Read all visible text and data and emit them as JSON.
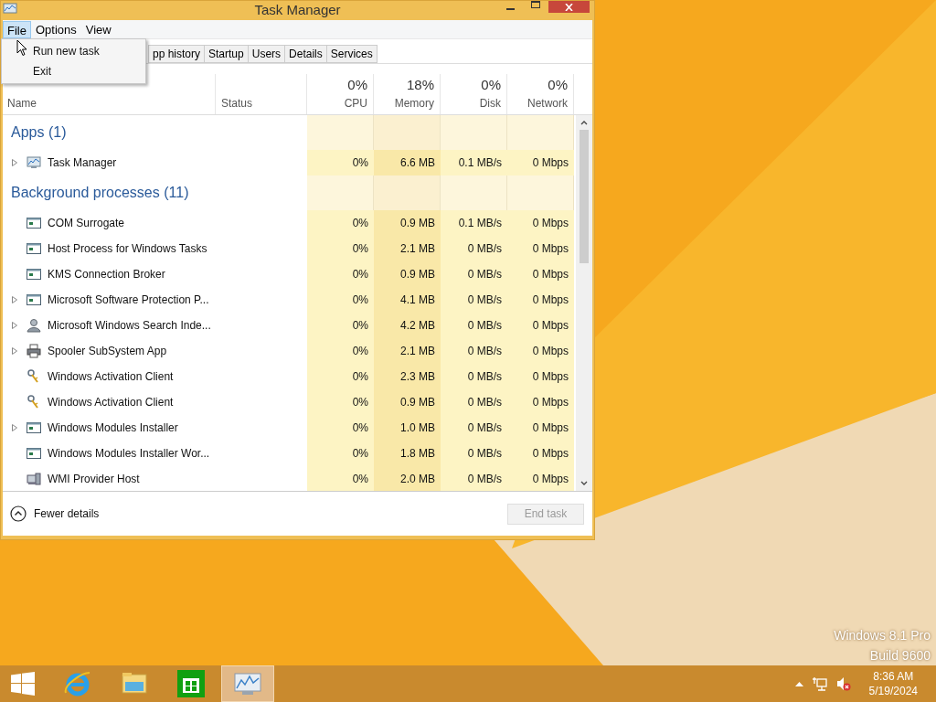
{
  "window": {
    "title": "Task Manager"
  },
  "menu_bar": [
    {
      "label": "File",
      "selected": true
    },
    {
      "label": "Options",
      "selected": false
    },
    {
      "label": "View",
      "selected": false
    }
  ],
  "file_menu": [
    "Run new task",
    "Exit"
  ],
  "tabs": [
    {
      "label": "pp history",
      "selected": false
    },
    {
      "label": "Startup",
      "selected": false
    },
    {
      "label": "Users",
      "selected": false
    },
    {
      "label": "Details",
      "selected": false
    },
    {
      "label": "Services",
      "selected": false
    }
  ],
  "columns": [
    {
      "label": "Name"
    },
    {
      "label": "Status"
    },
    {
      "label": "CPU",
      "usage": "0%"
    },
    {
      "label": "Memory",
      "usage": "18%"
    },
    {
      "label": "Disk",
      "usage": "0%"
    },
    {
      "label": "Network",
      "usage": "0%"
    }
  ],
  "rows": [
    {
      "kind": "group",
      "label": "Apps (1)"
    },
    {
      "kind": "monitor",
      "name": "Task Manager",
      "expandable": true,
      "cpu": "0%",
      "memory": "6.6 MB",
      "disk": "0.1 MB/s",
      "network": "0 Mbps"
    },
    {
      "kind": "group",
      "label": "Background processes (11)"
    },
    {
      "kind": "window",
      "name": "COM Surrogate",
      "expandable": false,
      "cpu": "0%",
      "memory": "0.9 MB",
      "disk": "0.1 MB/s",
      "network": "0 Mbps"
    },
    {
      "kind": "window",
      "name": "Host Process for Windows Tasks",
      "expandable": false,
      "cpu": "0%",
      "memory": "2.1 MB",
      "disk": "0 MB/s",
      "network": "0 Mbps"
    },
    {
      "kind": "window",
      "name": "KMS Connection Broker",
      "expandable": false,
      "cpu": "0%",
      "memory": "0.9 MB",
      "disk": "0 MB/s",
      "network": "0 Mbps"
    },
    {
      "kind": "window",
      "name": "Microsoft Software Protection P...",
      "expandable": true,
      "cpu": "0%",
      "memory": "4.1 MB",
      "disk": "0 MB/s",
      "network": "0 Mbps"
    },
    {
      "kind": "person",
      "name": "Microsoft Windows Search Inde...",
      "expandable": true,
      "cpu": "0%",
      "memory": "4.2 MB",
      "disk": "0 MB/s",
      "network": "0 Mbps"
    },
    {
      "kind": "printer",
      "name": "Spooler SubSystem App",
      "expandable": true,
      "cpu": "0%",
      "memory": "2.1 MB",
      "disk": "0 MB/s",
      "network": "0 Mbps"
    },
    {
      "kind": "keys",
      "name": "Windows Activation Client",
      "expandable": false,
      "cpu": "0%",
      "memory": "2.3 MB",
      "disk": "0 MB/s",
      "network": "0 Mbps"
    },
    {
      "kind": "keys",
      "name": "Windows Activation Client",
      "expandable": false,
      "cpu": "0%",
      "memory": "0.9 MB",
      "disk": "0 MB/s",
      "network": "0 Mbps"
    },
    {
      "kind": "window",
      "name": "Windows Modules Installer",
      "expandable": true,
      "cpu": "0%",
      "memory": "1.0 MB",
      "disk": "0 MB/s",
      "network": "0 Mbps"
    },
    {
      "kind": "window",
      "name": "Windows Modules Installer Wor...",
      "expandable": false,
      "cpu": "0%",
      "memory": "1.8 MB",
      "disk": "0 MB/s",
      "network": "0 Mbps"
    },
    {
      "kind": "computer",
      "name": "WMI Provider Host",
      "expandable": false,
      "cpu": "0%",
      "memory": "2.0 MB",
      "disk": "0 MB/s",
      "network": "0 Mbps"
    }
  ],
  "footer": {
    "details_toggle": "Fewer details",
    "end_task": {
      "label": "End task",
      "disabled": true
    }
  },
  "desktop_watermark": [
    "Windows 8.1 Pro",
    "Build 9600"
  ],
  "taskbar": {
    "apps": [
      {
        "kind": "ie",
        "selected": false
      },
      {
        "kind": "folder",
        "selected": false
      },
      {
        "kind": "store",
        "selected": false
      },
      {
        "kind": "taskmgr",
        "selected": true
      }
    ],
    "time": "8:36 AM",
    "date": "5/19/2024"
  }
}
